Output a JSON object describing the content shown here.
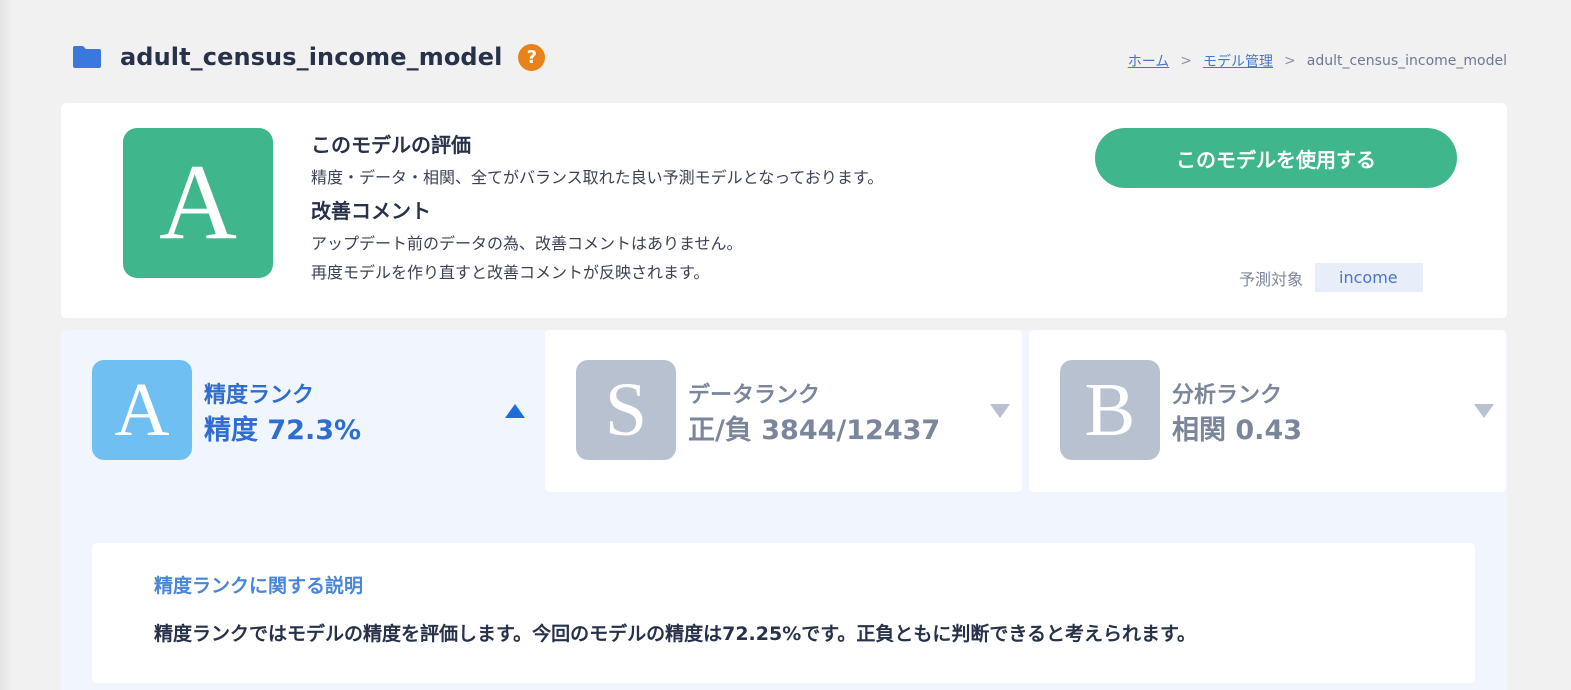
{
  "header": {
    "title": "adult_census_income_model",
    "help_icon": "?",
    "icons": {
      "folder": "folder-icon",
      "help": "question-icon"
    }
  },
  "breadcrumb": {
    "items": [
      "ホーム",
      "モデル管理",
      "adult_census_income_model"
    ],
    "separator": ">"
  },
  "summary": {
    "grade": "A",
    "evaluation_heading": "このモデルの評価",
    "evaluation_text": "精度・データ・相関、全てがバランス取れた良い予測モデルとなっております。",
    "improve_heading": "改善コメント",
    "improve_line1": "アップデート前のデータの為、改善コメントはありません。",
    "improve_line2": "再度モデルを作り直すと改善コメントが反映されます。",
    "use_button": "このモデルを使用する",
    "target_label": "予測対象",
    "target_value": "income"
  },
  "ranks": [
    {
      "grade": "A",
      "title": "精度ランク",
      "value": "精度 72.3%",
      "active": true
    },
    {
      "grade": "S",
      "title": "データランク",
      "value": "正/負 3844/12437",
      "active": false
    },
    {
      "grade": "B",
      "title": "分析ランク",
      "value": "相関 0.43",
      "active": false
    }
  ],
  "explanation": {
    "heading": "精度ランクに関する説明",
    "text": "精度ランクではモデルの精度を評価します。今回のモデルの精度は72.25%です。正負ともに判断できると考えられます。"
  },
  "colors": {
    "accent_green": "#3fb68c",
    "active_blue": "#70bff2",
    "inactive_grey": "#b8c1cf",
    "help_orange": "#e8831b",
    "link_blue": "#4a74c9"
  }
}
